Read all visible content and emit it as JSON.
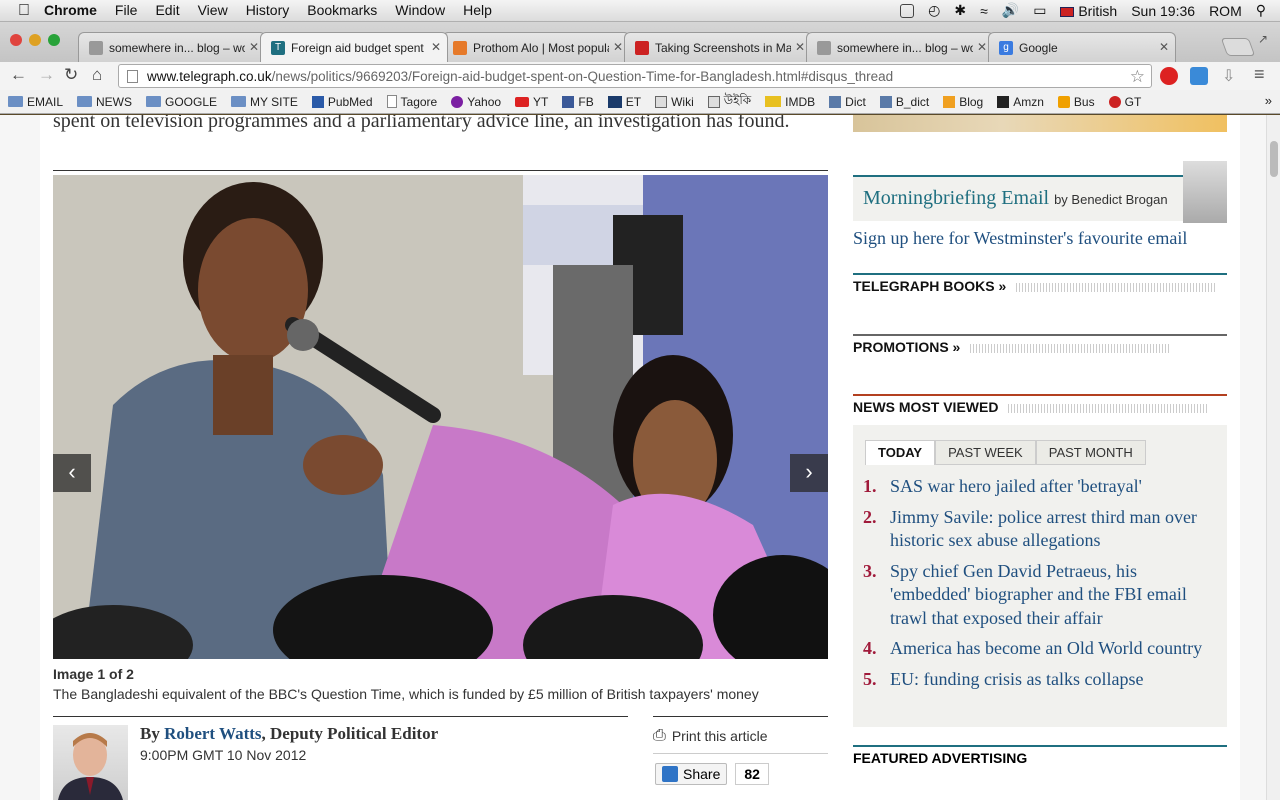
{
  "menubar": {
    "apple": "",
    "app": "Chrome",
    "menus": [
      "File",
      "Edit",
      "View",
      "History",
      "Bookmarks",
      "Window",
      "Help"
    ],
    "input_source": "British",
    "clock": "Sun 19:36",
    "user": "ROM"
  },
  "tabs": [
    {
      "title": "somewhere in... blog – wo",
      "fav_color": "#999"
    },
    {
      "title": "Foreign aid budget spent",
      "fav_color": "#1f6f80",
      "fav_text": "T"
    },
    {
      "title": "Prothom Alo | Most popula",
      "fav_color": "#e67a2a"
    },
    {
      "title": "Taking Screenshots in Ma",
      "fav_color": "#c22"
    },
    {
      "title": "somewhere in... blog – wo",
      "fav_color": "#999"
    },
    {
      "title": "Google",
      "fav_color": "#3a7be0",
      "fav_text": "g"
    }
  ],
  "omnibox": {
    "host": "www.telegraph.co.uk",
    "path": "/news/politics/9669203/Foreign-aid-budget-spent-on-Question-Time-for-Bangladesh.html#disqus_thread"
  },
  "bookmarks": [
    {
      "label": "EMAIL",
      "icon": "folder"
    },
    {
      "label": "NEWS",
      "icon": "folder"
    },
    {
      "label": "GOOGLE",
      "icon": "folder"
    },
    {
      "label": "MY SITE",
      "icon": "folder"
    },
    {
      "label": "PubMed",
      "icon": "pubmed"
    },
    {
      "label": "Tagore",
      "icon": "page"
    },
    {
      "label": "Yahoo",
      "icon": "yahoo"
    },
    {
      "label": "YT",
      "icon": "youtube"
    },
    {
      "label": "FB",
      "icon": "facebook"
    },
    {
      "label": "ET",
      "icon": "et"
    },
    {
      "label": "Wiki",
      "icon": "wiki"
    },
    {
      "label": "উইকি",
      "icon": "wiki"
    },
    {
      "label": "IMDB",
      "icon": "imdb"
    },
    {
      "label": "Dict",
      "icon": "dict"
    },
    {
      "label": "B_dict",
      "icon": "dict"
    },
    {
      "label": "Blog",
      "icon": "blog"
    },
    {
      "label": "Amzn",
      "icon": "amazon"
    },
    {
      "label": "Bus",
      "icon": "bus"
    },
    {
      "label": "GT",
      "icon": "gt"
    }
  ],
  "article": {
    "lead": "spent on television programmes and a parliamentary advice line, an investigation has found.",
    "image_counter": "Image 1 of 2",
    "caption": "The Bangladeshi equivalent of the BBC's Question Time, which is funded by £5 million of British taxpayers' money",
    "byline_prefix": "By",
    "author": "Robert Watts",
    "author_role": ", Deputy Political Editor",
    "date": "9:00PM GMT 10 Nov 2012",
    "print": "Print this article",
    "share": "Share",
    "share_count": "82"
  },
  "rail": {
    "morning_title": "Morningbriefing Email",
    "morning_by": "by Benedict Brogan",
    "signup": "Sign up here for Westminster's favourite email",
    "books": "TELEGRAPH BOOKS »",
    "promos": "PROMOTIONS »",
    "most_viewed": "NEWS MOST VIEWED",
    "tabs": [
      "TODAY",
      "PAST WEEK",
      "PAST MONTH"
    ],
    "items": [
      {
        "n": "1.",
        "t": "SAS war hero jailed after 'betrayal'"
      },
      {
        "n": "2.",
        "t": "Jimmy Savile: police arrest third man over historic sex abuse allegations"
      },
      {
        "n": "3.",
        "t": "Spy chief Gen David Petraeus, his 'embedded' biographer and the FBI email trawl that exposed their affair"
      },
      {
        "n": "4.",
        "t": "America has become an Old World country"
      },
      {
        "n": "5.",
        "t": "EU: funding crisis as talks collapse"
      }
    ],
    "featured": "FEATURED ADVERTISING"
  }
}
